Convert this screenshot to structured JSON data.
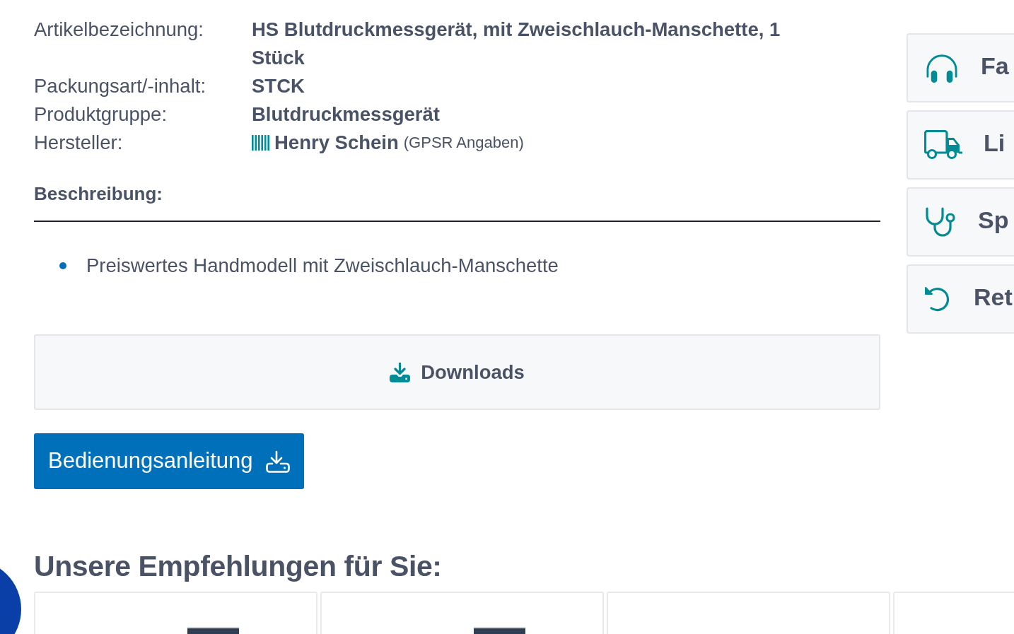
{
  "product_details": [
    {
      "kind": "text",
      "label": "Artikelbezeichnung:",
      "value": "HS Blutdruckmessgerät, mit Zweischlauch-Manschette, 1 Stück"
    },
    {
      "kind": "text",
      "label": "Packungsart/-inhalt:",
      "value": "STCK"
    },
    {
      "kind": "text",
      "label": "Produktgruppe:",
      "value": "Blutdruckmessgerät"
    },
    {
      "kind": "manufacturer",
      "label": "Hersteller:",
      "value": "Henry Schein",
      "link": "(GPSR Angaben)"
    }
  ],
  "description": {
    "heading": "Beschreibung:",
    "bullets": [
      "Preiswertes Handmodell mit Zweischlauch-Manschette"
    ]
  },
  "downloads": {
    "title": "Downloads",
    "buttons": [
      "Bedienungsanleitung"
    ]
  },
  "service_links": [
    "Fa",
    "Li",
    "Sp",
    "Ret"
  ],
  "recommendations": {
    "heading": "Unsere Empfehlungen für Sie:",
    "products": [
      {
        "photo_visible": true
      },
      {
        "photo_visible": true
      },
      {
        "photo_visible": false
      },
      {
        "photo_visible": false
      }
    ]
  }
}
